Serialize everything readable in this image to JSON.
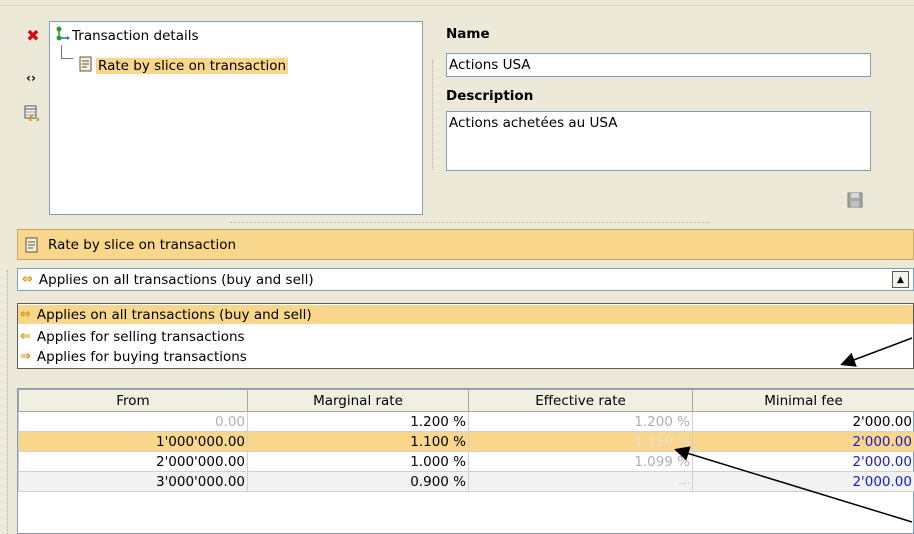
{
  "tree": {
    "root_label": "Transaction details",
    "child_label": "Rate by slice on transaction"
  },
  "form": {
    "name_label": "Name",
    "name_value": "Actions USA",
    "description_label": "Description",
    "description_value": "Actions achetées au USA"
  },
  "header_bar": {
    "label": "Rate by slice on transaction"
  },
  "combo": {
    "selected": "Applies on all transactions (buy and sell)"
  },
  "dropdown": {
    "options": [
      "Applies on all transactions (buy and sell)",
      "Applies for selling transactions",
      "Applies for buying transactions"
    ]
  },
  "table": {
    "columns": [
      "From",
      "Marginal rate",
      "Effective rate",
      "Minimal fee"
    ],
    "rows": [
      [
        "0.00",
        "1.200 %",
        "1.200 %",
        "2'000.00"
      ],
      [
        "1'000'000.00",
        "1.100 %",
        "1.150 %",
        "2'000.00"
      ],
      [
        "2'000'000.00",
        "1.000 %",
        "1.099 %",
        "2'000.00"
      ],
      [
        "3'000'000.00",
        "0.900 %",
        "....",
        "2'000.00"
      ]
    ]
  },
  "colors": {
    "selection": "#f8d78c",
    "link_blue": "#1a1ac8",
    "muted": "#b0b0b0"
  }
}
